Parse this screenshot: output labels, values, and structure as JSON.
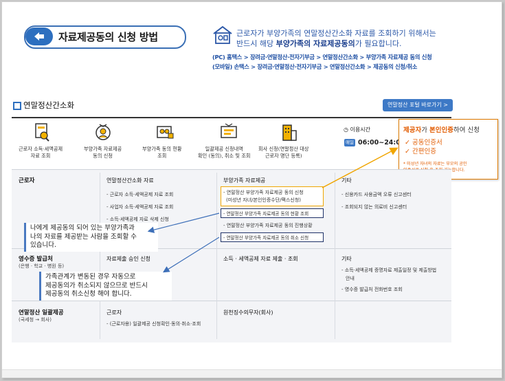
{
  "header": {
    "title": "자료제공동의 신청 방법",
    "notice_line1": "근로자가 부양가족의 연말정산간소화 자료를 조회하기 위해서는",
    "notice_line2_pre": "반드시 해당 ",
    "notice_line2_bold": "부양가족의 자료제공동의",
    "notice_line2_post": "가 필요합니다.",
    "path_pc": "(PC) 홈택스 > 장려금·연말정산·전자기부금 > 연말정산간소화 > 부양가족 자료제공 동의 신청",
    "path_mobile": "(모바일) 손택스 > 장려금·연말정산·전자기부금 > 연말정산간소화 > 제공동의 신청/취소"
  },
  "section": {
    "title": "연말정산간소화",
    "portal_button": "연말정산 포털 바로가기 >"
  },
  "services": [
    {
      "icon": "document-search-icon",
      "label1": "근로자 소득·세액공제",
      "label2": "자료 조회"
    },
    {
      "icon": "family-doc-icon",
      "label1": "부양가족 자료제공",
      "label2": "동의 신청"
    },
    {
      "icon": "family-status-icon",
      "label1": "부양가족 동의 현황",
      "label2": "조회"
    },
    {
      "icon": "submit-doc-icon",
      "label1": "일괄제공 신청내역",
      "label2": "확인 (동의), 취소 및 조회"
    },
    {
      "icon": "building-icon",
      "label1": "회사 신청(연말정산 대상",
      "label2": "근로자 명단 등록)"
    }
  ],
  "hours": {
    "label": "이용시간",
    "badge": "매일",
    "time": "06:00~24:00"
  },
  "popup": {
    "title_red": "제공자",
    "title_mid": "가 ",
    "title_red2": "본인인증",
    "title_post": "하여 신청",
    "option1": "✓ 공동인증서",
    "option2": "✓ 간편인증",
    "note1": "* 미성년 자녀의 자료는 부모의 공인",
    "note2": "인증서로 신청 후 조회 가능합니다."
  },
  "table": {
    "rows": [
      {
        "head": "근로자",
        "sub": "",
        "col1_head": "연말정산간소화 자료",
        "col1_items": [
          "- 근로자 소득·세액공제 자료 조회",
          "- 사업자 소득·세액공제 자료 조회",
          "- 소득·세액공제 자료 삭제 신청"
        ],
        "col2_head": "부양가족 자료제공",
        "col2_items": [
          "- 연말정산 부양가족 자료제공 동의 신청",
          "(미성년 자녀/본인인증수단/팩스신청)",
          "- 연말정산 부양가족 자료제공 동의 현황 조회",
          "- 연말정산 부양가족 자료제공 동의 진행상황",
          "- 연말정산 부양가족 자료제공 동의 취소 신청"
        ],
        "col3_head": "기타",
        "col3_items": [
          "- 신용카드 사용금액 오류 신고센터",
          "- 조회되지 않는 의료비 신고센터"
        ]
      },
      {
        "head": "영수증 발급처",
        "sub": "(은행 · 학교 · 병원 등)",
        "col1_head": "자료제출 승인 신청",
        "col2_head": "소득 · 세액공제 자료 제출 · 조회",
        "col3_head": "기타",
        "col3_items": [
          "- 소득·세액공제 증명자료 제출일정 및 제출방법",
          "안내",
          "- 영수증 발급처 전화번호 조회"
        ]
      },
      {
        "head": "연말정산 일괄제공",
        "sub": "(국세청 → 회사)",
        "col1_head": "근로자",
        "col1_items": [
          "- (근로자용) 일괄제공 신청확인·동의·취소·조회"
        ],
        "col2_head": "원천징수의무자(회사)"
      }
    ]
  },
  "callouts": {
    "c1": [
      "나에게 제공동의 되어 있는 부양가족과",
      "나의 자료를 제공받는 사람을 조회할 수",
      "있습니다."
    ],
    "c2": [
      "가족관계가 변동된 경우 자동으로",
      "제공동의가 취소되지 않으므로 반드시",
      "제공동의 취소신청 해야 합니다."
    ]
  },
  "colors": {
    "accent": "#3d79c6",
    "orange": "#f0a500",
    "navy": "#1c2f66",
    "red": "#e25c00"
  }
}
